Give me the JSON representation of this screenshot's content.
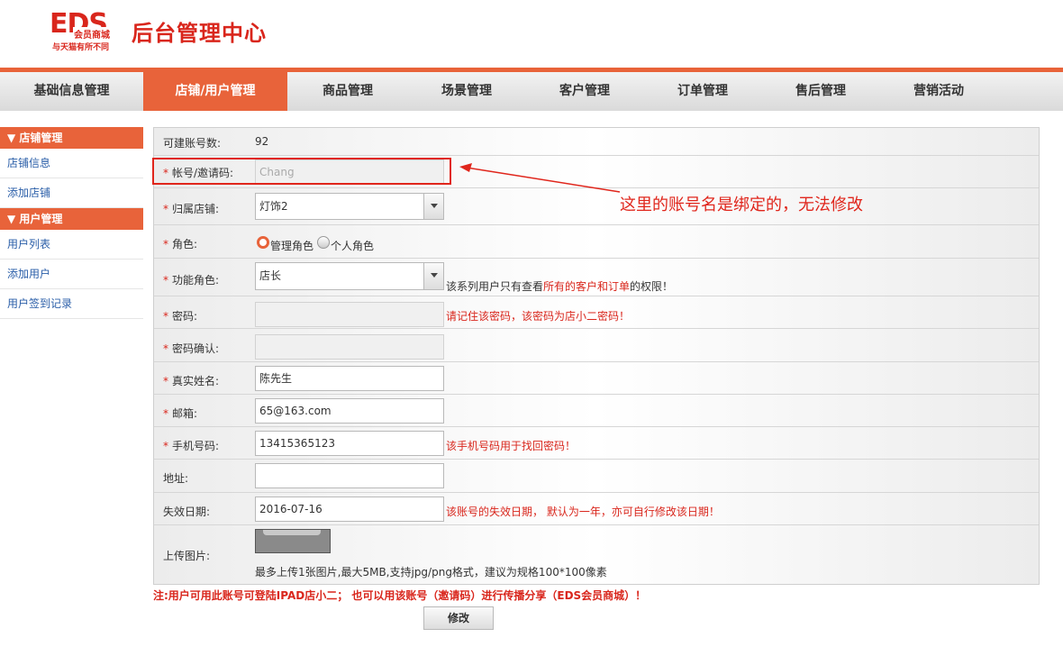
{
  "header": {
    "logo_text": "EDS",
    "logo_sub": "会员商城",
    "tagline": "与天猫有所不同",
    "title": "后台管理中心"
  },
  "nav": [
    {
      "label": "基础信息管理"
    },
    {
      "label": "店铺/用户管理"
    },
    {
      "label": "商品管理"
    },
    {
      "label": "场景管理"
    },
    {
      "label": "客户管理"
    },
    {
      "label": "订单管理"
    },
    {
      "label": "售后管理"
    },
    {
      "label": "营销活动"
    }
  ],
  "nav_active": "店铺/用户管理",
  "sidebar": {
    "sections": [
      {
        "title": "▼ 店铺管理",
        "items": [
          {
            "label": "店铺信息"
          },
          {
            "label": "添加店铺"
          }
        ]
      },
      {
        "title": "▼ 用户管理",
        "items": [
          {
            "label": "用户列表"
          },
          {
            "label": "添加用户"
          },
          {
            "label": "用户签到记录"
          }
        ]
      }
    ]
  },
  "form": {
    "count_label": "可建账号数:",
    "count_value": "92",
    "account_label": "帐号/邀请码:",
    "account_value": "Chang",
    "store_label": "归属店铺:",
    "store_value": "灯饰2",
    "role_label": "角色:",
    "role_options": [
      {
        "label": "管理角色",
        "selected": true
      },
      {
        "label": "个人角色",
        "selected": false
      }
    ],
    "func_role_label": "功能角色:",
    "func_role_value": "店长",
    "func_role_hint_a": "该系列用户只有查看",
    "func_role_hint_b": "所有的客户和订单",
    "func_role_hint_c": "的权限！",
    "password_label": "密码:",
    "password_hint": "请记住该密码，该密码为店小二密码！",
    "password_confirm_label": "密码确认:",
    "realname_label": "真实姓名:",
    "realname_value": "陈先生",
    "email_label": "邮箱:",
    "email_value": "65@163.com",
    "phone_label": "手机号码:",
    "phone_value": "13415365123",
    "phone_hint": "该手机号码用于找回密码！",
    "address_label": "地址:",
    "address_value": "",
    "expire_label": "失效日期:",
    "expire_value": "2016-07-16",
    "expire_hint": "该账号的失效日期， 默认为一年，亦可自行修改该日期！",
    "upload_label": "上传图片:",
    "upload_hint": "最多上传1张图片,最大5MB,支持jpg/png格式，建议为规格100*100像素",
    "required_mark": "*"
  },
  "note": "注:用户可用此账号可登陆IPAD店小二； 也可以用该账号（邀请码）进行传播分享（EDS会员商城）！",
  "submit_label": "修改",
  "callout": "这里的账号名是绑定的，无法修改",
  "colors": {
    "accent": "#e8633a",
    "warning": "#d9261c",
    "link": "#2a5ea8"
  }
}
